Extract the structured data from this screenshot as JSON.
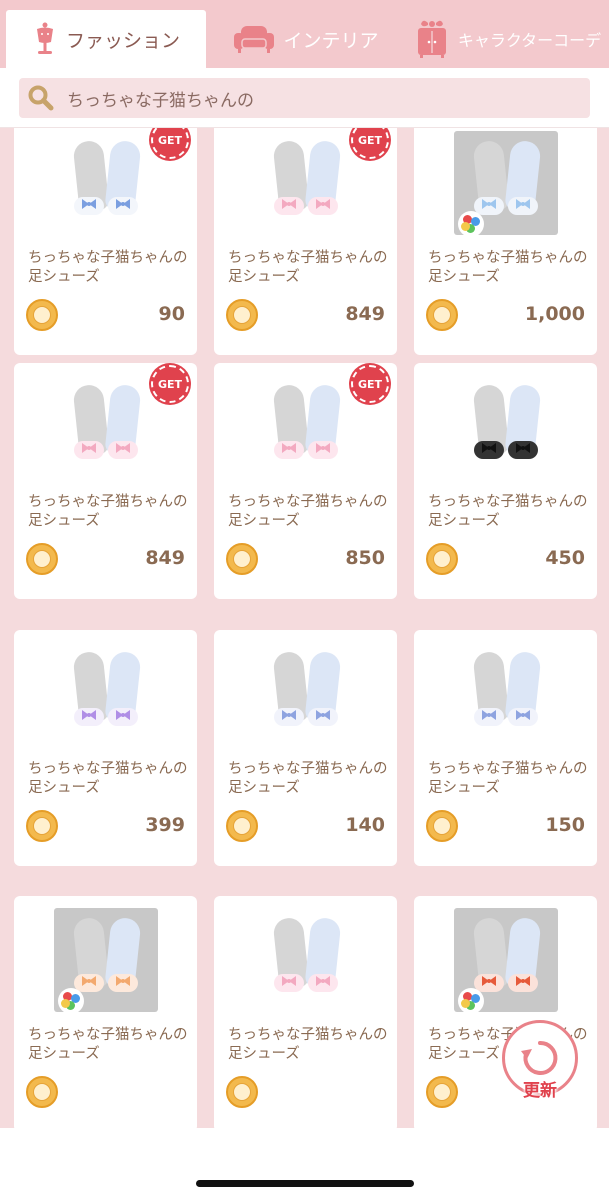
{
  "tabs": [
    {
      "label": "ファッション",
      "icon": "mannequin-icon",
      "active": true
    },
    {
      "label": "インテリア",
      "icon": "sofa-icon",
      "active": false
    },
    {
      "label": "キャラクターコーデ",
      "icon": "wardrobe-icon",
      "active": false
    }
  ],
  "search": {
    "text": "ちっちゃな子猫ちゃんの"
  },
  "badge_label": "GET",
  "items": [
    {
      "name": "ちっちゃな子猫ちゃんの足シューズ",
      "price": "90",
      "get": true,
      "palette": false,
      "bow_color": "#7b9fe0",
      "fluff_color": "#f3f6fb"
    },
    {
      "name": "ちっちゃな子猫ちゃんの足シューズ",
      "price": "849",
      "get": true,
      "palette": false,
      "bow_color": "#f3a9c0",
      "fluff_color": "#fde6ee"
    },
    {
      "name": "ちっちゃな子猫ちゃんの足シューズ",
      "price": "1,000",
      "get": false,
      "palette": true,
      "bow_color": "#9ec6ee",
      "fluff_color": "#f0f4fa"
    },
    {
      "name": "ちっちゃな子猫ちゃんの足シューズ",
      "price": "849",
      "get": true,
      "palette": false,
      "bow_color": "#f3a9c0",
      "fluff_color": "#fde6ee"
    },
    {
      "name": "ちっちゃな子猫ちゃんの足シューズ",
      "price": "850",
      "get": true,
      "palette": false,
      "bow_color": "#f3a9c0",
      "fluff_color": "#fde6ee"
    },
    {
      "name": "ちっちゃな子猫ちゃんの足シューズ",
      "price": "450",
      "get": false,
      "palette": false,
      "bow_color": "#111111",
      "fluff_color": "#333333"
    },
    {
      "name": "ちっちゃな子猫ちゃんの足シューズ",
      "price": "399",
      "get": false,
      "palette": false,
      "bow_color": "#b08ee6",
      "fluff_color": "#f3effb"
    },
    {
      "name": "ちっちゃな子猫ちゃんの足シューズ",
      "price": "140",
      "get": false,
      "palette": false,
      "bow_color": "#8ea3e0",
      "fluff_color": "#f1f3fb"
    },
    {
      "name": "ちっちゃな子猫ちゃんの足シューズ",
      "price": "150",
      "get": false,
      "palette": false,
      "bow_color": "#8ea3e0",
      "fluff_color": "#f1f3fb"
    },
    {
      "name": "ちっちゃな子猫ちゃんの足シューズ",
      "price": "",
      "get": false,
      "palette": true,
      "bow_color": "#f3a96f",
      "fluff_color": "#fde9dc"
    },
    {
      "name": "ちっちゃな子猫ちゃんの足シューズ",
      "price": "",
      "get": false,
      "palette": false,
      "bow_color": "#f3a9c0",
      "fluff_color": "#fde6ee"
    },
    {
      "name": "ちっちゃな子猫ちゃんの足シューズ",
      "price": "",
      "get": false,
      "palette": true,
      "bow_color": "#e65a3a",
      "fluff_color": "#fbe2da"
    }
  ],
  "refresh": {
    "label": "更新",
    "icon": "refresh-icon"
  },
  "colors": {
    "tab_bg": "#f3c9cd",
    "grid_bg": "#f5dbdd",
    "text": "#8a6a52",
    "accent_red": "#e0424d",
    "coin": "#f3b94d"
  }
}
